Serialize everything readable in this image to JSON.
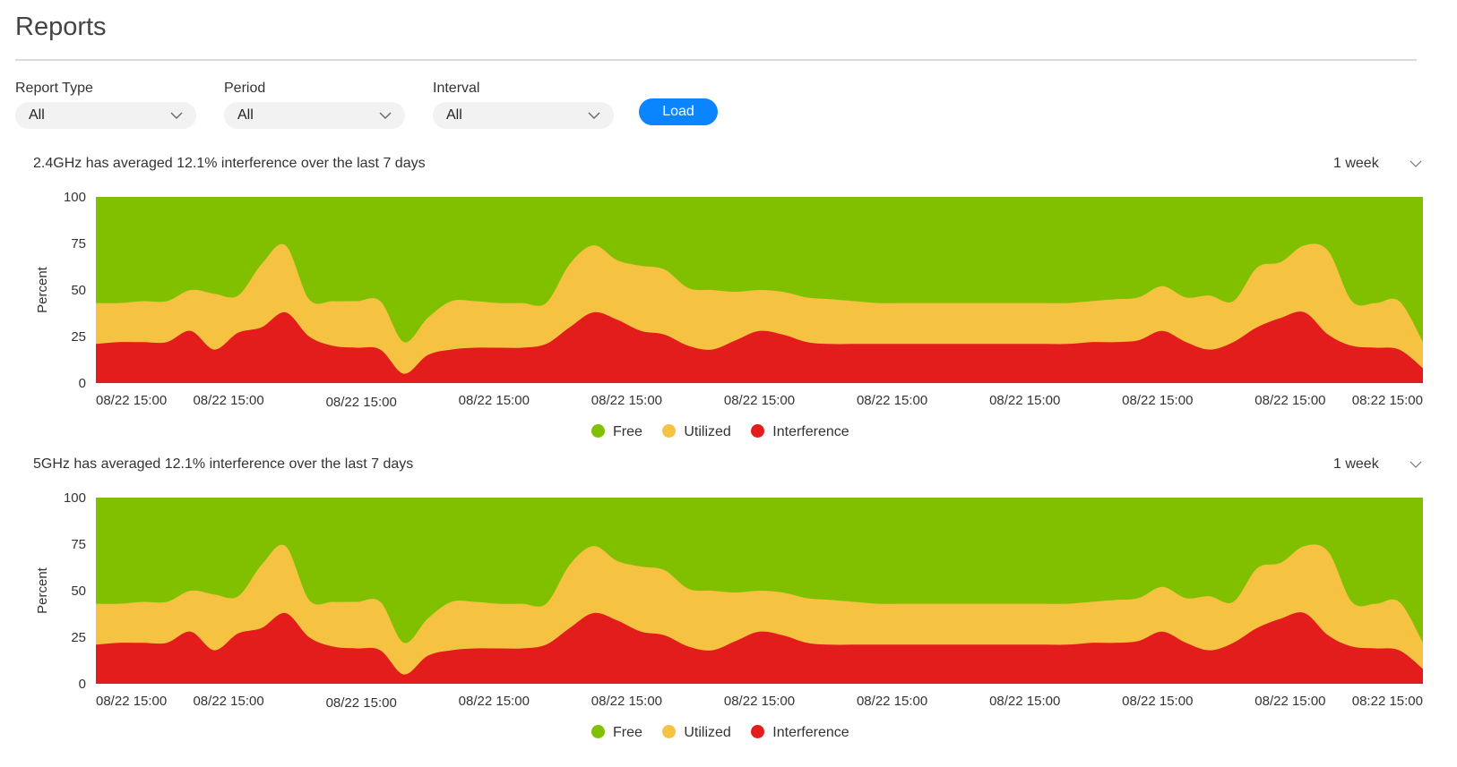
{
  "page": {
    "title": "Reports"
  },
  "filters": [
    {
      "label": "Report Type",
      "value": "All"
    },
    {
      "label": "Period",
      "value": "All"
    },
    {
      "label": "Interval",
      "value": "All"
    }
  ],
  "load_label": "Load",
  "colors": {
    "free": "#80c000",
    "utilized": "#f5c242",
    "interference": "#e31c1c",
    "accent": "#0a84ff"
  },
  "legend": [
    {
      "name": "Free",
      "color": "#80c000"
    },
    {
      "name": "Utilized",
      "color": "#f5c242"
    },
    {
      "name": "Interference",
      "color": "#e31c1c"
    }
  ],
  "charts": [
    {
      "caption": "2.4GHz has averaged 12.1% interference over the last 7 days",
      "range": "1 week"
    },
    {
      "caption": "5GHz has averaged 12.1% interference over the last 7 days",
      "range": "1 week"
    }
  ],
  "chart_data": [
    {
      "type": "area",
      "title": "2.4GHz has averaged 12.1% interference over the last 7 days",
      "ylabel": "Percent",
      "ylim": [
        0,
        100
      ],
      "yticks": [
        0,
        25,
        50,
        75,
        100
      ],
      "xtick_labels": [
        "08/22 15:00",
        "08/22 15:00",
        "08/22 15:00",
        "08/22 15:00",
        "08/22 15:00",
        "08/22 15:00",
        "08/22 15:00",
        "08/22 15:00",
        "08/22 15:00",
        "08/22 15:00",
        "08:22 15:00"
      ],
      "grid": false,
      "legend": "bottom-center",
      "series": [
        {
          "name": "Interference",
          "values": [
            21,
            22,
            22,
            22,
            28,
            18,
            27,
            30,
            38,
            25,
            20,
            19,
            18,
            5,
            15,
            18,
            19,
            19,
            19,
            21,
            30,
            38,
            34,
            28,
            26,
            20,
            18,
            23,
            28,
            26,
            22,
            21,
            21,
            21,
            21,
            21,
            21,
            21,
            21,
            21,
            21,
            21,
            22,
            22,
            23,
            28,
            22,
            18,
            22,
            30,
            35,
            38,
            26,
            20,
            19,
            18,
            8
          ]
        },
        {
          "name": "Utilized",
          "values": [
            22,
            21,
            22,
            22,
            22,
            30,
            20,
            34,
            36,
            20,
            24,
            25,
            26,
            17,
            20,
            26,
            25,
            24,
            24,
            22,
            34,
            36,
            32,
            35,
            35,
            31,
            32,
            26,
            22,
            23,
            24,
            24,
            23,
            22,
            22,
            22,
            22,
            22,
            22,
            22,
            22,
            22,
            22,
            23,
            23,
            24,
            24,
            29,
            22,
            32,
            30,
            36,
            45,
            24,
            24,
            26,
            14
          ]
        },
        {
          "name": "Free",
          "values": [
            57,
            57,
            56,
            56,
            50,
            52,
            53,
            36,
            26,
            55,
            56,
            56,
            56,
            78,
            65,
            56,
            56,
            57,
            57,
            57,
            36,
            26,
            34,
            37,
            39,
            49,
            50,
            51,
            50,
            51,
            54,
            55,
            56,
            57,
            57,
            57,
            57,
            57,
            57,
            57,
            57,
            57,
            56,
            55,
            54,
            48,
            54,
            53,
            56,
            38,
            35,
            26,
            29,
            56,
            57,
            56,
            78
          ]
        }
      ]
    },
    {
      "type": "area",
      "title": "5GHz has averaged 12.1% interference over the last 7 days",
      "ylabel": "Percent",
      "ylim": [
        0,
        100
      ],
      "yticks": [
        0,
        25,
        50,
        75,
        100
      ],
      "xtick_labels": [
        "08/22 15:00",
        "08/22 15:00",
        "08/22 15:00",
        "08/22 15:00",
        "08/22 15:00",
        "08/22 15:00",
        "08/22 15:00",
        "08/22 15:00",
        "08/22 15:00",
        "08/22 15:00",
        "08:22 15:00"
      ],
      "grid": false,
      "legend": "bottom-center",
      "series": [
        {
          "name": "Interference",
          "values": [
            21,
            22,
            22,
            22,
            28,
            18,
            27,
            30,
            38,
            25,
            20,
            19,
            18,
            5,
            15,
            18,
            19,
            19,
            19,
            21,
            30,
            38,
            34,
            28,
            26,
            20,
            18,
            23,
            28,
            26,
            22,
            21,
            21,
            21,
            21,
            21,
            21,
            21,
            21,
            21,
            21,
            21,
            22,
            22,
            23,
            28,
            22,
            18,
            22,
            30,
            35,
            38,
            26,
            20,
            19,
            18,
            8
          ]
        },
        {
          "name": "Utilized",
          "values": [
            22,
            21,
            22,
            22,
            22,
            30,
            20,
            34,
            36,
            20,
            24,
            25,
            26,
            17,
            20,
            26,
            25,
            24,
            24,
            22,
            34,
            36,
            32,
            35,
            35,
            31,
            32,
            26,
            22,
            23,
            24,
            24,
            23,
            22,
            22,
            22,
            22,
            22,
            22,
            22,
            22,
            22,
            22,
            23,
            23,
            24,
            24,
            29,
            22,
            32,
            30,
            36,
            45,
            24,
            24,
            26,
            14
          ]
        },
        {
          "name": "Free",
          "values": [
            57,
            57,
            56,
            56,
            50,
            52,
            53,
            36,
            26,
            55,
            56,
            56,
            56,
            78,
            65,
            56,
            56,
            57,
            57,
            57,
            36,
            26,
            34,
            37,
            39,
            49,
            50,
            51,
            50,
            51,
            54,
            55,
            56,
            57,
            57,
            57,
            57,
            57,
            57,
            57,
            57,
            57,
            56,
            55,
            54,
            48,
            54,
            53,
            56,
            38,
            35,
            26,
            29,
            56,
            57,
            56,
            78
          ]
        }
      ]
    }
  ]
}
